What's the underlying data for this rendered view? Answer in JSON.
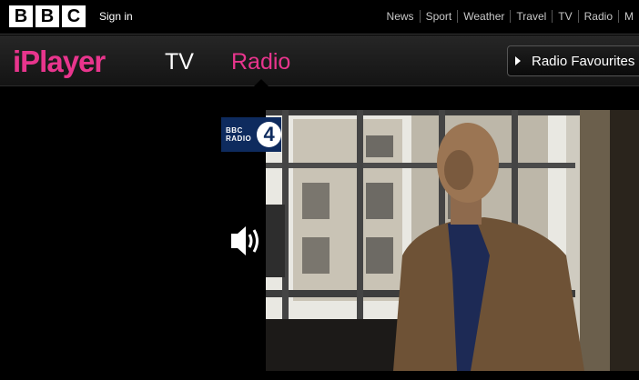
{
  "global_bar": {
    "logo_letters": [
      "B",
      "B",
      "C"
    ],
    "sign_in": "Sign in",
    "nav": [
      "News",
      "Sport",
      "Weather",
      "Travel",
      "TV",
      "Radio",
      "M"
    ]
  },
  "iplayer_bar": {
    "logo": "iPlayer",
    "tabs": [
      "TV",
      "Radio"
    ],
    "active_tab": "Radio",
    "favourites_label": "Radio Favourites"
  },
  "stage": {
    "channel": {
      "brand_line1": "BBC",
      "brand_line2": "RADIO",
      "number": "4"
    },
    "volume_icon": "speaker-volume-icon"
  },
  "colors": {
    "accent": "#e8358d",
    "background": "#000000",
    "channel_blue": "#0e2b5e"
  }
}
